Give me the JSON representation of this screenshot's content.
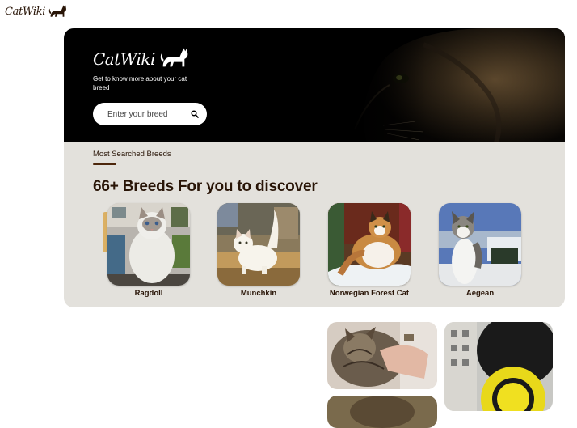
{
  "header": {
    "logo_text": "CatWiki",
    "logo_icon": "cat-silhouette-icon"
  },
  "hero": {
    "logo_text": "CatWiki",
    "logo_icon": "cat-silhouette-icon",
    "tagline": "Get to know more about your cat breed",
    "search": {
      "placeholder": "Enter your breed",
      "value": "",
      "icon": "search-icon"
    }
  },
  "breeds_section": {
    "label": "Most Searched Breeds",
    "headline": "66+ Breeds For you to discover",
    "breeds": [
      {
        "name": "Ragdoll"
      },
      {
        "name": "Munchkin"
      },
      {
        "name": "Norwegian Forest Cat"
      },
      {
        "name": "Aegean"
      }
    ]
  },
  "colors": {
    "brand_dark": "#291507",
    "panel_bg": "#e3e1dc",
    "hero_bg": "#000000",
    "accent": "#dbb064"
  }
}
